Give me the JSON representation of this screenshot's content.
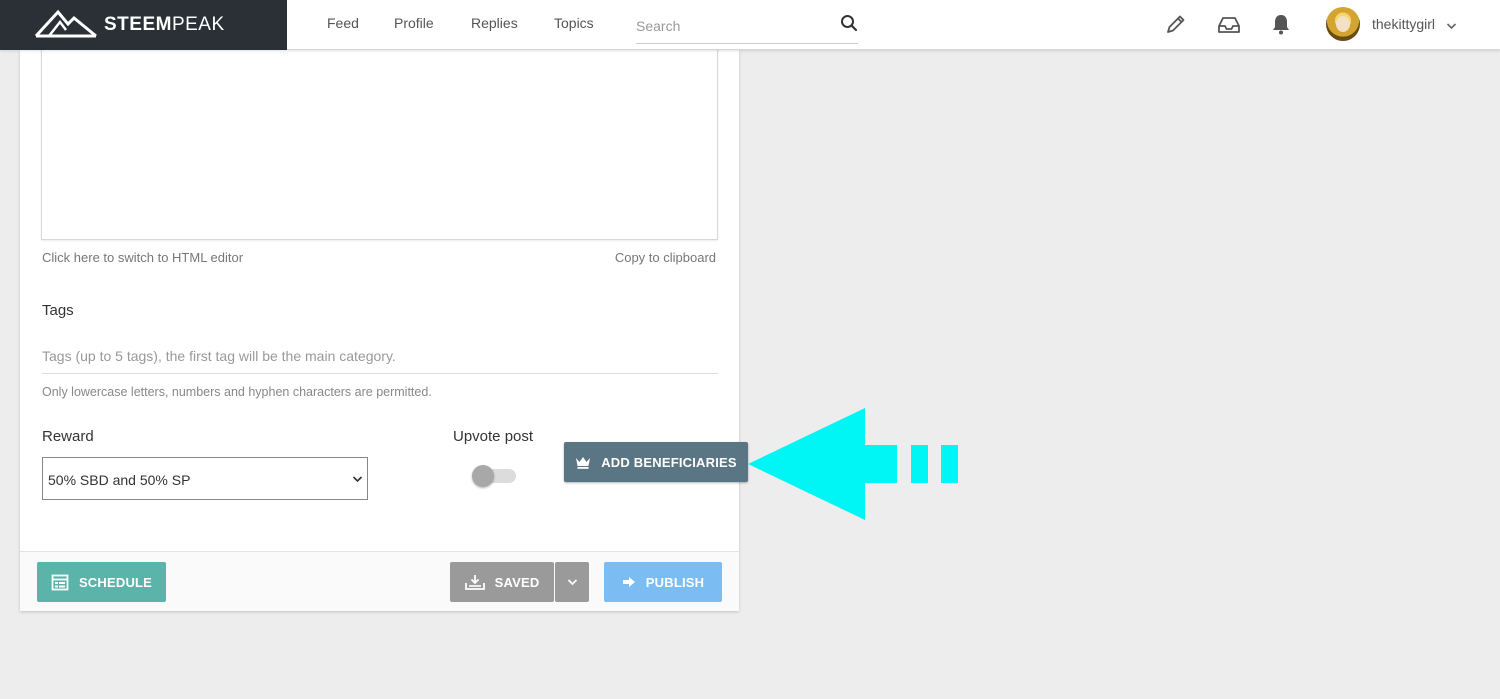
{
  "brand": {
    "name_prefix": "STEEM",
    "name_suffix": "PEAK"
  },
  "nav": {
    "items": [
      "Feed",
      "Profile",
      "Replies",
      "Topics"
    ]
  },
  "search": {
    "placeholder": "Search"
  },
  "user": {
    "name": "thekittygirl"
  },
  "editor": {
    "switch_link": "Click here to switch to HTML editor",
    "copy_link": "Copy to clipboard"
  },
  "tags": {
    "label": "Tags",
    "placeholder": "Tags (up to 5 tags), the first tag will be the main category.",
    "hint": "Only lowercase letters, numbers and hyphen characters are permitted."
  },
  "reward": {
    "label": "Reward",
    "selected": "50% SBD and 50% SP"
  },
  "upvote": {
    "label": "Upvote post",
    "enabled": false
  },
  "buttons": {
    "beneficiaries": "ADD BENEFICIARIES",
    "schedule": "SCHEDULE",
    "saved": "SAVED",
    "publish": "PUBLISH"
  },
  "colors": {
    "brand_bg": "#2b3036",
    "beneficiaries": "#5a7584",
    "schedule": "#5ab4a9",
    "saved": "#9a9a9a",
    "publish": "#7bbcf3",
    "arrow": "#00f5f5"
  }
}
